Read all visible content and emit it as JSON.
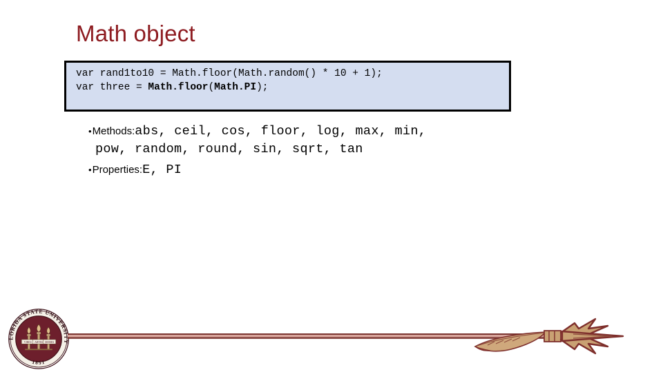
{
  "slide": {
    "title": "Math object",
    "title_color": "#8d1b20",
    "background_color": "#ffffff"
  },
  "code_block": {
    "background_color": "#d4ddf0",
    "border_color": "#000000",
    "lines": [
      {
        "segments": [
          {
            "text": "var rand1to10 = Math.floor(Math.random() * 10 + 1);",
            "bold": false
          }
        ]
      },
      {
        "segments": [
          {
            "text": "var three = ",
            "bold": false
          },
          {
            "text": "Math.floor",
            "bold": true
          },
          {
            "text": "(",
            "bold": false
          },
          {
            "text": "Math.PI",
            "bold": true
          },
          {
            "text": ");",
            "bold": false
          }
        ]
      }
    ],
    "line1_plain": "var rand1to10 = Math.floor(Math.random() * 10 + 1);"
  },
  "bullets": [
    {
      "bullet_char": "•",
      "label": "Methods:",
      "value_line_1": "abs, ceil, cos, floor, log, max, min,",
      "value_line_2": "pow, random, round, sin, sqrt, tan"
    },
    {
      "bullet_char": "•",
      "label": "Properties:",
      "value_line_1": "E, PI",
      "value_line_2": ""
    }
  ],
  "footer": {
    "seal": {
      "name": "florida-state-university-seal",
      "ring_text_top": "FLORIDA STATE UNIVERSITY",
      "year": "1851",
      "banner_left": "VIRES",
      "banner_center": "ARTES",
      "banner_right": "MORES",
      "disc_color": "#6d1f2c",
      "ring_color": "#f3efe6",
      "outline_color": "#4a1420",
      "torch_color": "#c9a97a",
      "flame_color": "#e0bc86"
    },
    "spear": {
      "name": "fsu-spear",
      "shaft_dark_color": "#7a3430",
      "shaft_light_color": "#d9a49a",
      "head_fill_color": "#c9a173",
      "head_outline_color": "#7e2f2c",
      "feather_fill_color": "#cfa87c"
    }
  }
}
